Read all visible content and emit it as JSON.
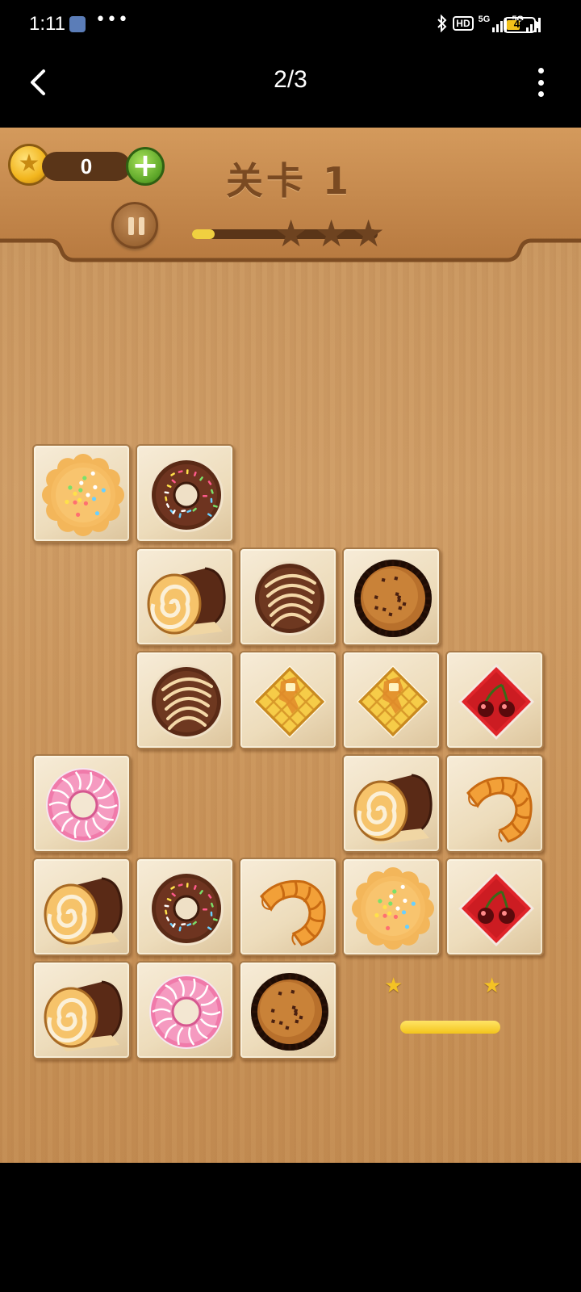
{
  "status_bar": {
    "time": "1:11",
    "more_icons": "•••",
    "hd_label": "HD",
    "network_1": "5G",
    "network_2": "5G",
    "battery_level": "41"
  },
  "app_bar": {
    "title": "2/3",
    "back_icon": "chevron-left-icon",
    "menu_icon": "more-vertical-icon"
  },
  "game": {
    "coins": "0",
    "level_title": "关卡 1",
    "level_progress": 0.12,
    "progress_stars": 3,
    "hint_stars": 2,
    "hint_progress": 1.0,
    "colors": {
      "wood": "#c8935a",
      "panel": "#c18447",
      "text_brown": "#7a4a22",
      "gold": "#f4c224"
    }
  },
  "board": {
    "tiles": [
      {
        "row": 0,
        "col": 0,
        "item": "cookie"
      },
      {
        "row": 0,
        "col": 1,
        "item": "chocolate-donut"
      },
      {
        "row": 1,
        "col": 1,
        "item": "swiss-roll"
      },
      {
        "row": 1,
        "col": 2,
        "item": "drizzled-chocolate"
      },
      {
        "row": 1,
        "col": 3,
        "item": "chocolate-chip-muffin"
      },
      {
        "row": 2,
        "col": 1,
        "item": "drizzled-chocolate"
      },
      {
        "row": 2,
        "col": 2,
        "item": "waffle"
      },
      {
        "row": 2,
        "col": 3,
        "item": "waffle"
      },
      {
        "row": 2,
        "col": 4,
        "item": "cherry-diamond"
      },
      {
        "row": 3,
        "col": 0,
        "item": "pink-donut"
      },
      {
        "row": 3,
        "col": 3,
        "item": "swiss-roll"
      },
      {
        "row": 3,
        "col": 4,
        "item": "croissant"
      },
      {
        "row": 4,
        "col": 0,
        "item": "swiss-roll"
      },
      {
        "row": 4,
        "col": 1,
        "item": "chocolate-donut"
      },
      {
        "row": 4,
        "col": 2,
        "item": "croissant"
      },
      {
        "row": 4,
        "col": 3,
        "item": "cookie"
      },
      {
        "row": 4,
        "col": 4,
        "item": "cherry-diamond"
      },
      {
        "row": 5,
        "col": 0,
        "item": "swiss-roll"
      },
      {
        "row": 5,
        "col": 1,
        "item": "pink-donut"
      },
      {
        "row": 5,
        "col": 2,
        "item": "chocolate-chip-muffin"
      }
    ]
  }
}
